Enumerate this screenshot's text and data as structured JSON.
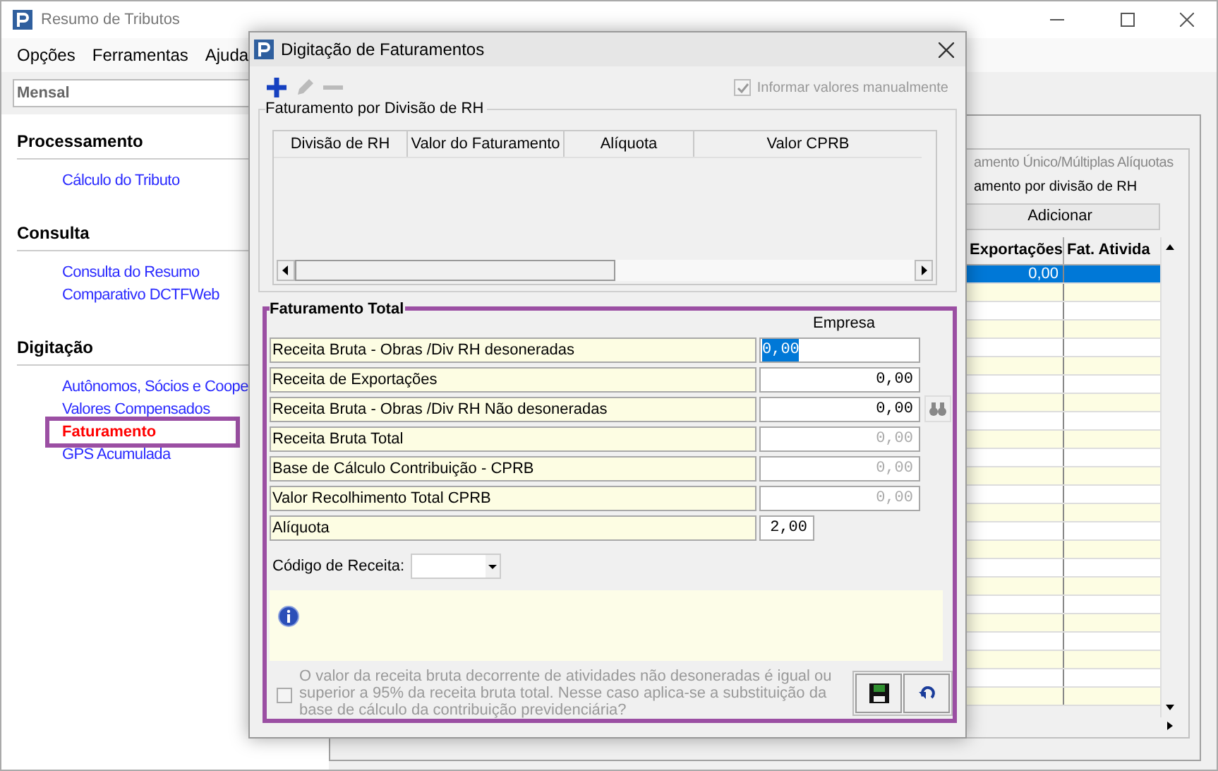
{
  "main_window": {
    "title": "Resumo de Tributos",
    "menu": [
      {
        "label": "Opções"
      },
      {
        "label": "Ferramentas"
      },
      {
        "label": "Ajuda"
      }
    ],
    "period": {
      "value": "Mensal"
    },
    "sidebar": [
      {
        "heading": "Processamento",
        "items": [
          {
            "label": "Cálculo do Tributo",
            "selected": false
          }
        ]
      },
      {
        "heading": "Consulta",
        "items": [
          {
            "label": "Consulta do Resumo",
            "selected": false
          },
          {
            "label": "Comparativo DCTFWeb",
            "selected": false
          }
        ]
      },
      {
        "heading": "Digitação",
        "items": [
          {
            "label": "Autônomos, Sócios e Coope",
            "selected": false
          },
          {
            "label": "Valores Compensados",
            "selected": false
          },
          {
            "label": "Faturamento",
            "selected": true
          },
          {
            "label": "GPS Acumulada",
            "selected": false
          }
        ]
      }
    ],
    "panel": {
      "option_1": "amento Único/Múltiplas Alíquotas",
      "option_2": "amento por divisão de RH",
      "add_button": "Adicionar",
      "table": {
        "columns": [
          "Exportações",
          "Fat. Ativida"
        ],
        "rows": [
          {
            "cells": [
              "0,00",
              ""
            ],
            "selected": true
          }
        ]
      }
    }
  },
  "dialog": {
    "title": "Digitação de Faturamentos",
    "toolbar": [
      {
        "kind": "add",
        "disabled": false
      },
      {
        "kind": "edit",
        "disabled": true
      },
      {
        "kind": "remove",
        "disabled": true
      }
    ],
    "manual_values": {
      "label": "Informar valores manualmente",
      "checked": true,
      "disabled": true
    },
    "division_group": {
      "title": "Faturamento por Divisão de RH",
      "columns": [
        "Divisão de RH",
        "Valor do Faturamento",
        "Alíquota",
        "Valor CPRB"
      ]
    },
    "total_group": {
      "title": "Faturamento Total",
      "column_header": "Empresa",
      "fields": [
        {
          "label": "Receita Bruta - Obras /Div RH desoneradas",
          "value": "0,00",
          "kind": "amount",
          "selected": true,
          "disabled": false
        },
        {
          "label": "Receita de Exportações",
          "value": "0,00",
          "kind": "amount",
          "selected": false,
          "disabled": false
        },
        {
          "label": "Receita Bruta - Obras /Div RH Não desoneradas",
          "value": "0,00",
          "kind": "lookup",
          "selected": false,
          "disabled": false
        },
        {
          "label": "Receita Bruta Total",
          "value": "0,00",
          "kind": "amount",
          "selected": false,
          "disabled": true
        },
        {
          "label": "Base de Cálculo Contribuição - CPRB",
          "value": "0,00",
          "kind": "amount",
          "selected": false,
          "disabled": true
        },
        {
          "label": "Valor Recolhimento Total CPRB",
          "value": "0,00",
          "kind": "amount",
          "selected": false,
          "disabled": true
        },
        {
          "label": "Alíquota",
          "value": "2,00",
          "kind": "short",
          "selected": false,
          "disabled": false
        }
      ],
      "revenue_code": {
        "label": "Código de Receita:"
      },
      "substitution": {
        "label": "O valor da receita bruta decorrente de atividades não desoneradas é igual ou superior a 95% da receita bruta total. Nesse caso aplica-se a substituição da base de cálculo da contribuição previdenciária?",
        "checked": false,
        "disabled": true
      }
    }
  }
}
